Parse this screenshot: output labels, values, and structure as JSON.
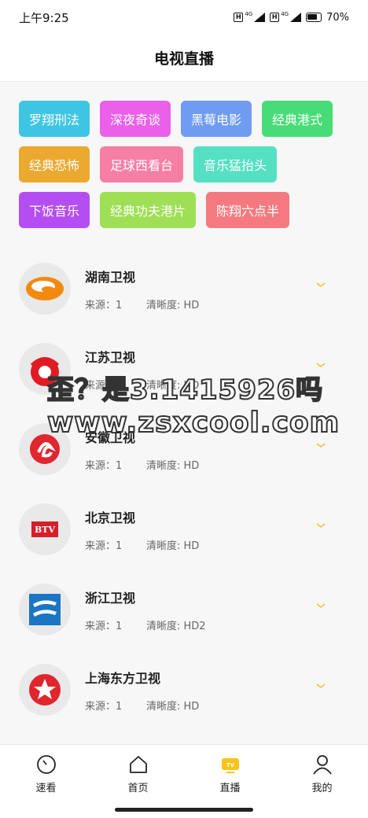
{
  "status": {
    "time": "上午9:25",
    "net": "4G",
    "battery": "70%"
  },
  "header": {
    "title": "电视直播"
  },
  "tags": [
    [
      {
        "label": "罗翔刑法",
        "color": "#3ec5e3"
      },
      {
        "label": "深夜奇谈",
        "color": "#ea60e8"
      },
      {
        "label": "黑莓电影",
        "color": "#6f9cf2"
      },
      {
        "label": "经典港式",
        "color": "#47dc78"
      }
    ],
    [
      {
        "label": "经典恐怖",
        "color": "#eca930"
      },
      {
        "label": "足球西看台",
        "color": "#f57fa5"
      },
      {
        "label": "音乐猛抬头",
        "color": "#55e0c3"
      }
    ],
    [
      {
        "label": "下饭音乐",
        "color": "#b44ef2"
      },
      {
        "label": "经典功夫港片",
        "color": "#9fdf55"
      },
      {
        "label": "陈翔六点半",
        "color": "#f47a7f"
      }
    ]
  ],
  "channels": [
    {
      "name": "湖南卫视",
      "source": "来源：1",
      "quality": "清晰度: HD",
      "logo": "hunan-tv-logo"
    },
    {
      "name": "江苏卫视",
      "source": "来源：1",
      "quality": "清晰度: HD",
      "logo": "jiangsu-tv-logo"
    },
    {
      "name": "安徽卫视",
      "source": "来源：1",
      "quality": "清晰度: HD",
      "logo": "anhui-tv-logo"
    },
    {
      "name": "北京卫视",
      "source": "来源：1",
      "quality": "清晰度: HD",
      "logo": "btv-logo",
      "logo_text": "BTV"
    },
    {
      "name": "浙江卫视",
      "source": "来源：1",
      "quality": "清晰度: HD2",
      "logo": "zhejiang-tv-logo"
    },
    {
      "name": "上海东方卫视",
      "source": "来源：1",
      "quality": "清晰度: HD",
      "logo": "dragon-tv-logo"
    }
  ],
  "watermark": {
    "line1": "歪？是3.1415926吗",
    "line2": "www.zsxcool.com"
  },
  "tabs": [
    {
      "label": "速看",
      "icon": "clock-icon"
    },
    {
      "label": "首页",
      "icon": "home-icon"
    },
    {
      "label": "直播",
      "icon": "tv-icon",
      "active": true
    },
    {
      "label": "我的",
      "icon": "user-icon"
    }
  ],
  "colors": {
    "accent": "#f5c518",
    "chevron": "#f0c23a"
  }
}
